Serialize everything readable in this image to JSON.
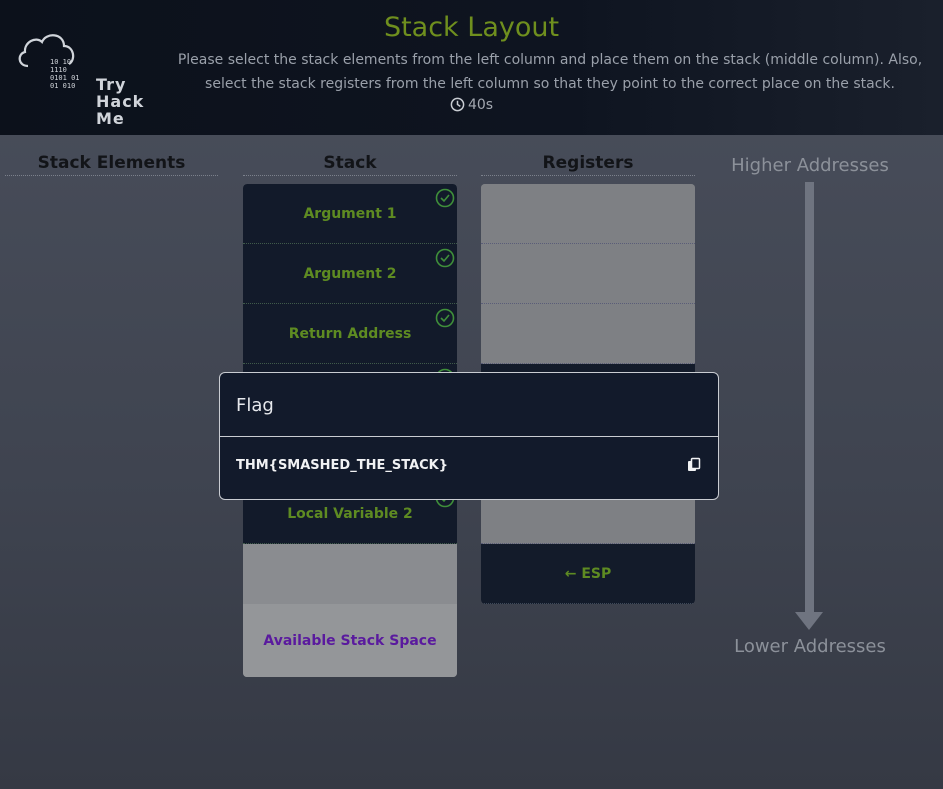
{
  "header": {
    "logo_text_lines": [
      "Try",
      "Hack",
      "Me"
    ],
    "logo_bits": "10 10\n1110\n0101 01\n01 010",
    "title": "Stack Layout",
    "subtitle": "Please select the stack elements from the left column and place them on the stack (middle column). Also, select the stack registers from the left column so that they point to the correct place on the stack.",
    "timer": "40s",
    "timer_icon": "clock-icon"
  },
  "columns": {
    "elements": "Stack Elements",
    "stack": "Stack",
    "registers": "Registers"
  },
  "stack_cells": [
    {
      "label": "Argument 1",
      "checked": true
    },
    {
      "label": "Argument 2",
      "checked": true
    },
    {
      "label": "Return Address",
      "checked": true
    },
    {
      "label": "",
      "checked": true
    },
    {
      "label": "",
      "checked": true
    },
    {
      "label": "Local Variable 2",
      "checked": true
    }
  ],
  "available_space": "Available Stack Space",
  "registers": [
    {
      "label": ""
    },
    {
      "label": ""
    },
    {
      "label": ""
    },
    {
      "label": ""
    },
    {
      "label": ""
    },
    {
      "label": ""
    },
    {
      "label": "← ESP"
    }
  ],
  "addresses": {
    "higher": "Higher Addresses",
    "lower": "Lower Addresses"
  },
  "modal": {
    "title": "Flag",
    "flag": "THM{SMASHED_THE_STACK}",
    "copy_icon": "copy-icon"
  },
  "colors": {
    "accent_green": "#6f8f1e",
    "cell_dark": "#121a2a",
    "available_purple": "#5a1a9e"
  }
}
